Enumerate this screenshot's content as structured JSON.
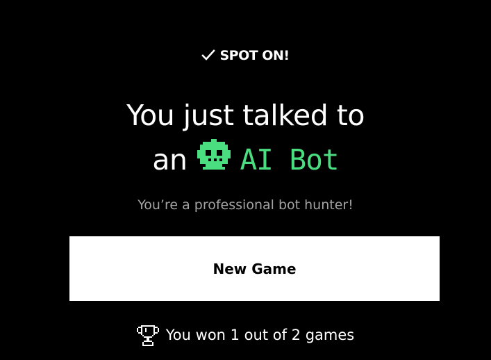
{
  "result": {
    "verdict_icon": "check-icon",
    "verdict": "SPOT ON!",
    "headline_line1": "You just talked to",
    "headline_prefix": "an",
    "bot_icon": "robot-icon",
    "bot_label": "AI Bot",
    "subtitle": "You’re a professional bot hunter!"
  },
  "actions": {
    "new_game_label": "New Game"
  },
  "score": {
    "icon": "trophy-icon",
    "text": "You won 1 out of 2 games"
  },
  "colors": {
    "background": "#000000",
    "text": "#ffffff",
    "muted_text": "#a3a3a3",
    "bot_accent": "#4ade80",
    "button_background": "#ffffff",
    "button_text": "#000000"
  }
}
